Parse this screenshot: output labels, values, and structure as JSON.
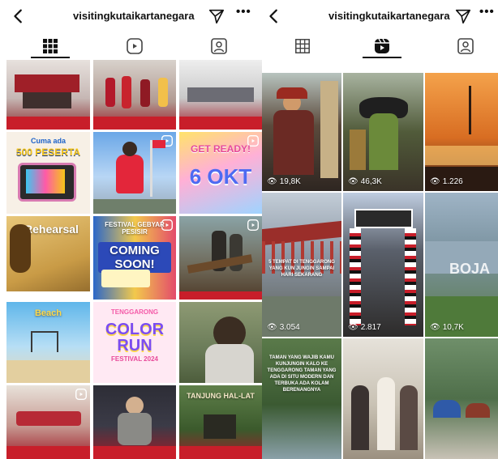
{
  "profile": {
    "username": "visitingkutaikartanegara"
  },
  "icons": {
    "back": "chevron-left-icon",
    "send": "paper-plane-icon",
    "more": "more-horizontal-icon"
  },
  "tabs": [
    "grid-icon",
    "reels-icon",
    "tagged-icon"
  ],
  "left_grid": {
    "tiles": [
      {
        "id": "event-stage-1",
        "overlay": ""
      },
      {
        "id": "dance-performance",
        "overlay": ""
      },
      {
        "id": "seminar-audience",
        "overlay": ""
      },
      {
        "id": "kuota-peserta",
        "overlay_top": "Cuma ada",
        "overlay_main": "500 PESERTA"
      },
      {
        "id": "girl-flags",
        "overlay": ""
      },
      {
        "id": "get-ready",
        "overlay_top": "GET READY!",
        "overlay_main": "6 OKT"
      },
      {
        "id": "rehearsal",
        "overlay_main": "Rehearsal"
      },
      {
        "id": "festival-pesisir",
        "overlay_top": "FESTIVAL GEBYAR PESISIR",
        "overlay_main": "COMING SOON!"
      },
      {
        "id": "field-trip",
        "overlay": ""
      },
      {
        "id": "beach",
        "overlay_main": "Beach"
      },
      {
        "id": "color-run",
        "overlay_top": "TENGGARONG",
        "overlay_main": "COLOR RUN",
        "overlay_sub": "FESTIVAL 2024"
      },
      {
        "id": "man-portrait",
        "overlay": ""
      },
      {
        "id": "hall-tables",
        "overlay": ""
      },
      {
        "id": "speaker-podium",
        "overlay": ""
      },
      {
        "id": "tanjung-hal-lat",
        "overlay_main": "TANJUNG HAL-LAT"
      }
    ]
  },
  "right_grid": {
    "tiles": [
      {
        "id": "dayak-costume-1",
        "views": "19,8K"
      },
      {
        "id": "dayak-dance",
        "views": "46,3K"
      },
      {
        "id": "sunset-pier",
        "views": "1.226"
      },
      {
        "id": "bridge-river",
        "views": "3.054",
        "caption": "5 TEMPAT DI TENGGARONG YANG KUN JUNGIN SAMPAI HARI SEKARANG"
      },
      {
        "id": "dayak-gate",
        "views": "2.817"
      },
      {
        "id": "lake-sign",
        "views": "10,7K",
        "sign": "BOJA"
      },
      {
        "id": "jungle-pool",
        "views": "",
        "caption": "TAMAN YANG WAJIB KAMU KUNJUNGIN KALO KE TENGGARONG TAMAN YANG ADA DI SITU MODERN DAN TERBUKA ADA KOLAM BERENANGNYA"
      },
      {
        "id": "girls-pose",
        "views": ""
      },
      {
        "id": "camping-forest",
        "views": ""
      }
    ]
  }
}
